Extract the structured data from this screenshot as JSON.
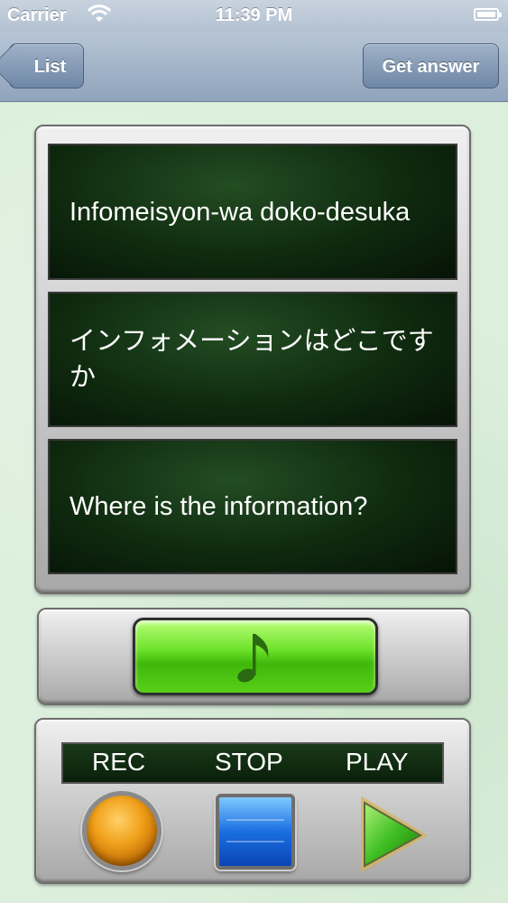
{
  "status_bar": {
    "carrier": "Carrier",
    "time": "11:39 PM",
    "icons": [
      "wifi-icon",
      "battery-icon"
    ]
  },
  "nav_bar": {
    "back_label": "List",
    "answer_label": "Get answer"
  },
  "cards": [
    "Infomeisyon-wa doko-desuka",
    "インフォメーションはどこですか",
    "Where is the information?"
  ],
  "music_button": {
    "icon": "music-note-icon"
  },
  "controls": {
    "rec_label": "REC",
    "stop_label": "STOP",
    "play_label": "PLAY"
  },
  "colors": {
    "nav_bar": "#9fb1c7",
    "card_bg": "#0f2a0f",
    "music_green": "#6fe22b",
    "rec_orange": "#f0a01a",
    "stop_blue": "#1a6fe0",
    "play_green": "#3fbf22"
  }
}
